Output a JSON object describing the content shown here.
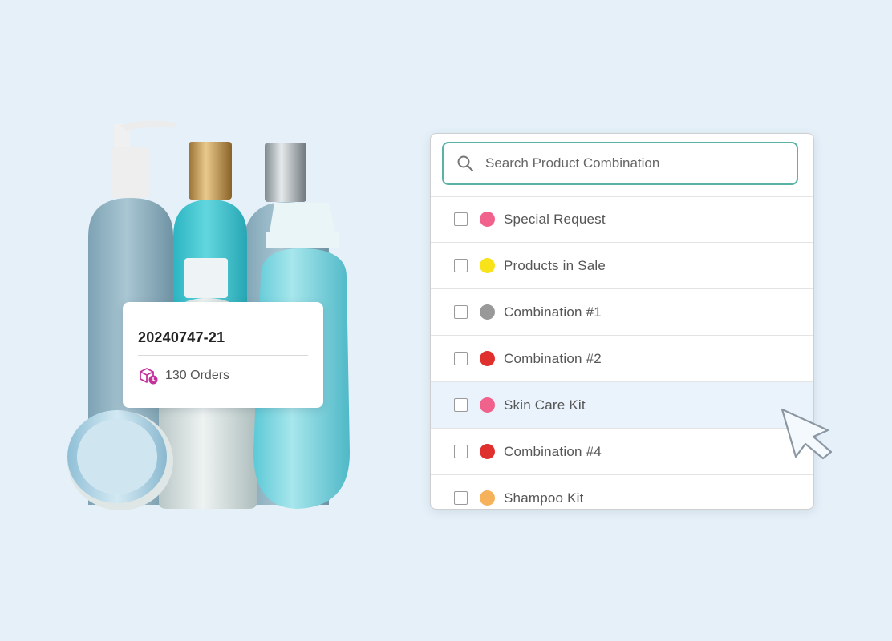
{
  "order_card": {
    "order_id": "20240747-21",
    "orders_text": "130 Orders",
    "icon": "package-clock-icon"
  },
  "search": {
    "placeholder": "Search Product Combination",
    "value": "",
    "icon": "search-icon"
  },
  "combinations": [
    {
      "label": "Special Request",
      "color": "#f0628c",
      "checked": false
    },
    {
      "label": "Products in Sale",
      "color": "#f8e21a",
      "checked": false
    },
    {
      "label": "Combination #1",
      "color": "#999999",
      "checked": false
    },
    {
      "label": "Combination #2",
      "color": "#e0302e",
      "checked": false
    },
    {
      "label": "Skin Care Kit",
      "color": "#f0628c",
      "checked": false,
      "hovered": true
    },
    {
      "label": "Combination #4",
      "color": "#e0302e",
      "checked": false
    },
    {
      "label": "Shampoo Kit",
      "color": "#f5b25b",
      "checked": false
    }
  ],
  "colors": {
    "background": "#e5f0f9",
    "search_border": "#5bb3a8",
    "hover_row": "#eaf2fb",
    "orders_icon": "#c4319b"
  }
}
